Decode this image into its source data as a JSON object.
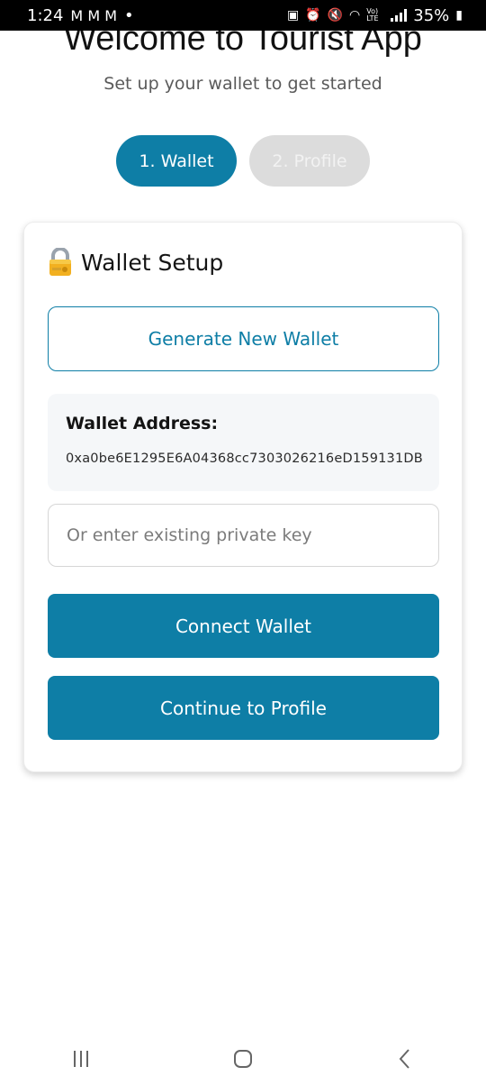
{
  "status_bar": {
    "time": "1:24",
    "notif_icons": "M M M",
    "dot": "•",
    "net_label": "Vo) LTE",
    "battery": "35%"
  },
  "header": {
    "title": "Welcome to Tourist App",
    "subtitle": "Set up your wallet to get started"
  },
  "steps": [
    {
      "label": "1. Wallet",
      "state": "active"
    },
    {
      "label": "2. Profile",
      "state": "inactive"
    }
  ],
  "card": {
    "icon": "lock-with-key-icon",
    "title": "Wallet Setup",
    "generate_label": "Generate New Wallet",
    "address_label": "Wallet Address:",
    "address_value": "0xa0be6E1295E6A04368cc7303026216eD159131DB",
    "private_key_placeholder": "Or enter existing private key",
    "connect_label": "Connect Wallet",
    "continue_label": "Continue to Profile"
  },
  "nav": {
    "recents_icon": "recents-icon",
    "home_icon": "home-icon",
    "back_icon": "back-icon"
  },
  "colors": {
    "accent": "#0e7ea6",
    "inactive_step": "#dcdcdc",
    "address_bg": "#f5f7f9"
  }
}
